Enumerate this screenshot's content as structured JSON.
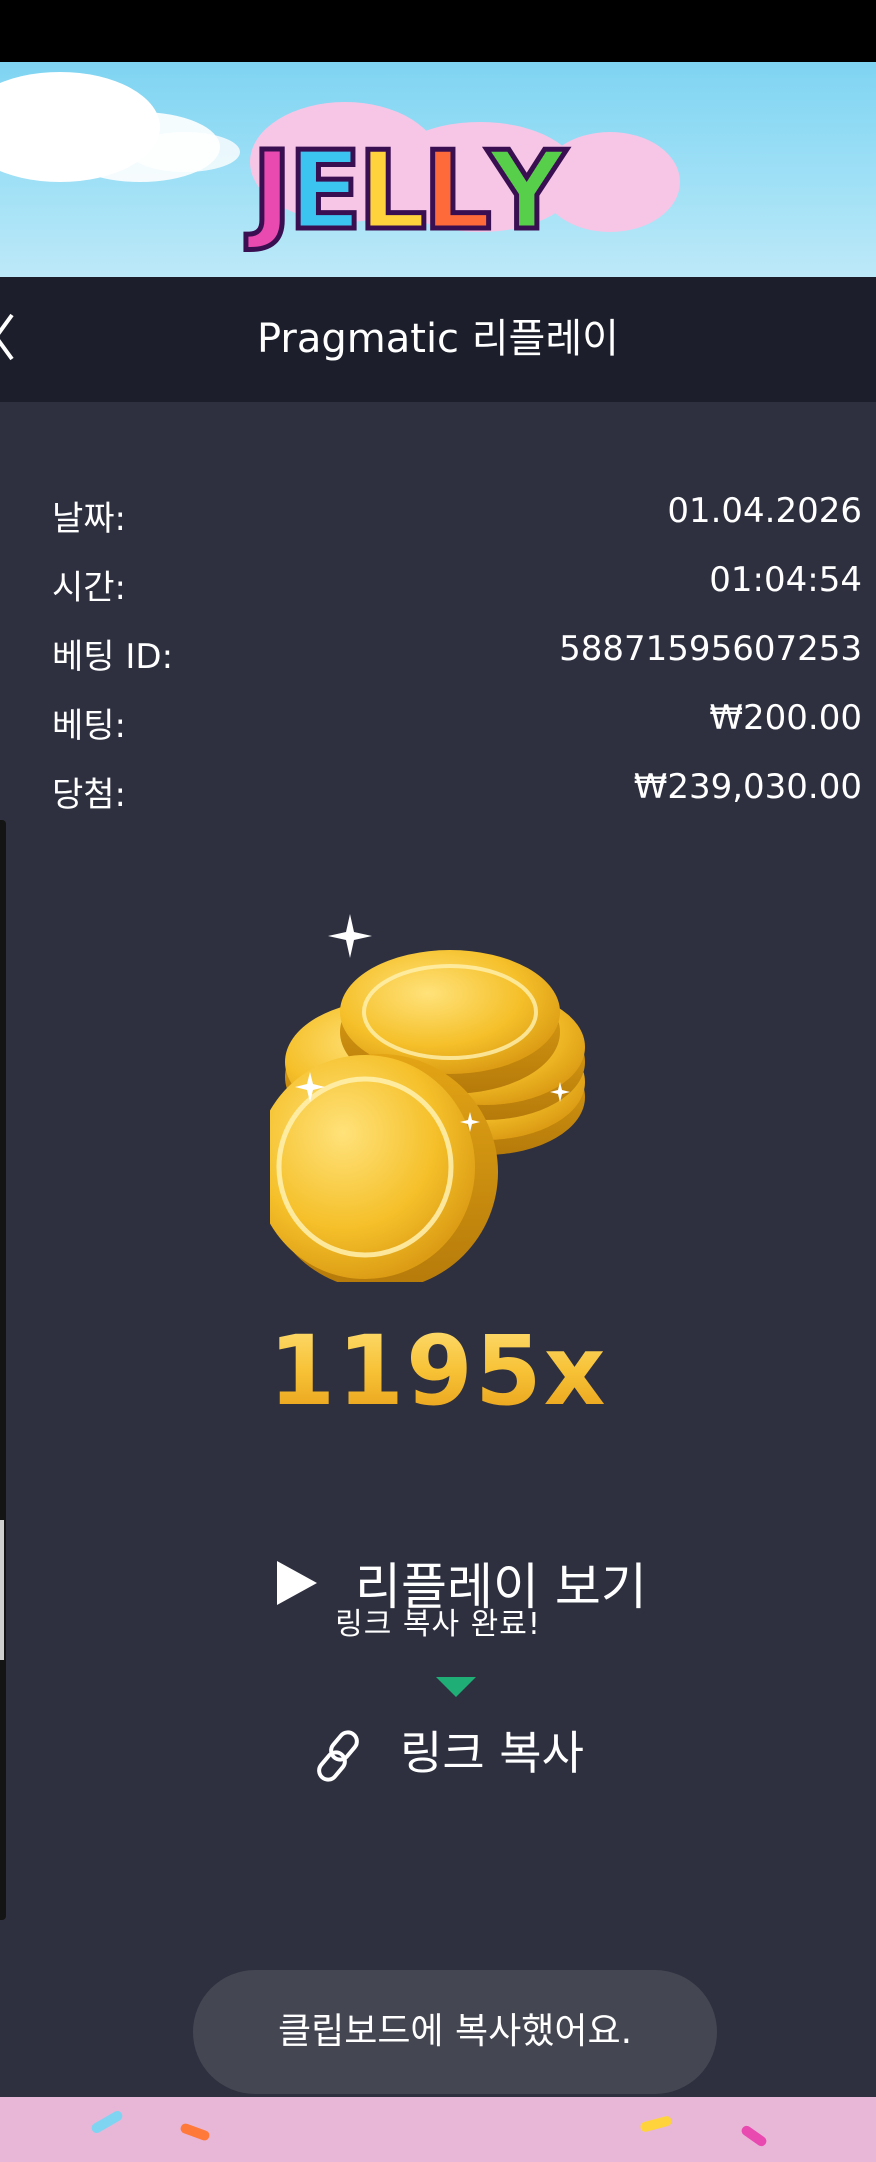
{
  "status_bar": {},
  "banner": {
    "logo_letters": [
      "J",
      "E",
      "L",
      "L",
      "Y"
    ],
    "logo_colors": [
      "#e94ab0",
      "#3cc4f0",
      "#ffd33c",
      "#ff6a3a",
      "#57cf4a"
    ]
  },
  "header": {
    "title": "Pragmatic 리플레이",
    "back_icon": "chevron-left-icon"
  },
  "details": {
    "date_label": "날짜:",
    "date_value": "01.04.2026",
    "time_label": "시간:",
    "time_value": "01:04:54",
    "bet_id_label": "베팅 ID:",
    "bet_id_value": "58871595607253",
    "bet_label": "베팅:",
    "bet_value": "₩200.00",
    "win_label": "당첨:",
    "win_value": "₩239,030.00"
  },
  "result": {
    "multiplier": "1195x",
    "image": "gold-coins-icon"
  },
  "actions": {
    "replay_label": "리플레이 보기",
    "replay_icon": "play-icon",
    "tooltip": "링크 복사 완료!",
    "copy_label": "링크 복사",
    "copy_icon": "link-icon"
  },
  "toast": {
    "message": "클립보드에 복사했어요."
  },
  "colors": {
    "panel": "#2e3040",
    "header": "#1c1f2b",
    "tooltip_arrow": "#1fae76",
    "gold": "#f5c233"
  }
}
